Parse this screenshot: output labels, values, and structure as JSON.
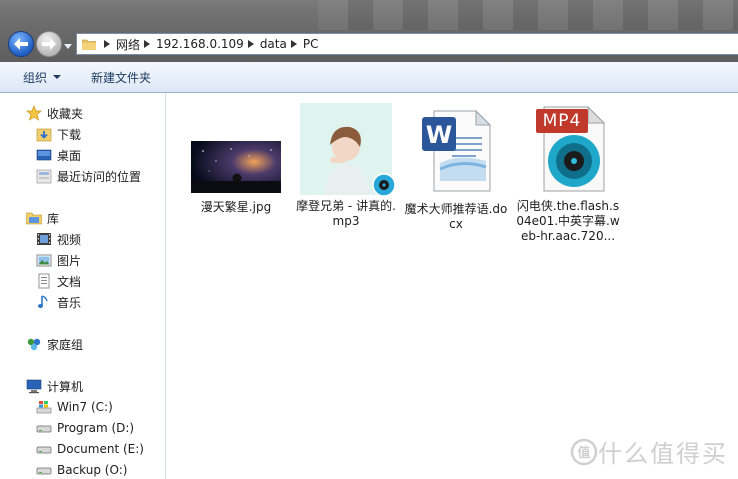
{
  "address_bar": {
    "crumbs": [
      "网络",
      "192.168.0.109",
      "data",
      "PC"
    ]
  },
  "toolbar": {
    "organize_label": "组织",
    "new_folder_label": "新建文件夹"
  },
  "nav_pane": {
    "favorites": {
      "label": "收藏夹",
      "items": [
        "下载",
        "桌面",
        "最近访问的位置"
      ]
    },
    "libraries": {
      "label": "库",
      "items": [
        "视频",
        "图片",
        "文档",
        "音乐"
      ]
    },
    "homegroup_label": "家庭组",
    "computer": {
      "label": "计算机",
      "items": [
        "Win7 (C:)",
        "Program (D:)",
        "Document (E:)",
        "Backup (O:)"
      ]
    }
  },
  "files": [
    {
      "name": "漫天繁星.jpg",
      "type": "jpg"
    },
    {
      "name": "摩登兄弟 - 讲真的.mp3",
      "type": "mp3"
    },
    {
      "name": "魔术大师推荐语.docx",
      "type": "docx"
    },
    {
      "name": "闪电侠.the.flash.s04e01.中英字幕.web-hr.aac.720...",
      "type": "mp4",
      "badge": "MP4"
    }
  ],
  "watermark": {
    "text": "什么值得买"
  },
  "colors": {
    "toolbar_text": "#1e3a5f",
    "mp4_badge": "#c0392b",
    "word_blue": "#2b579a"
  }
}
